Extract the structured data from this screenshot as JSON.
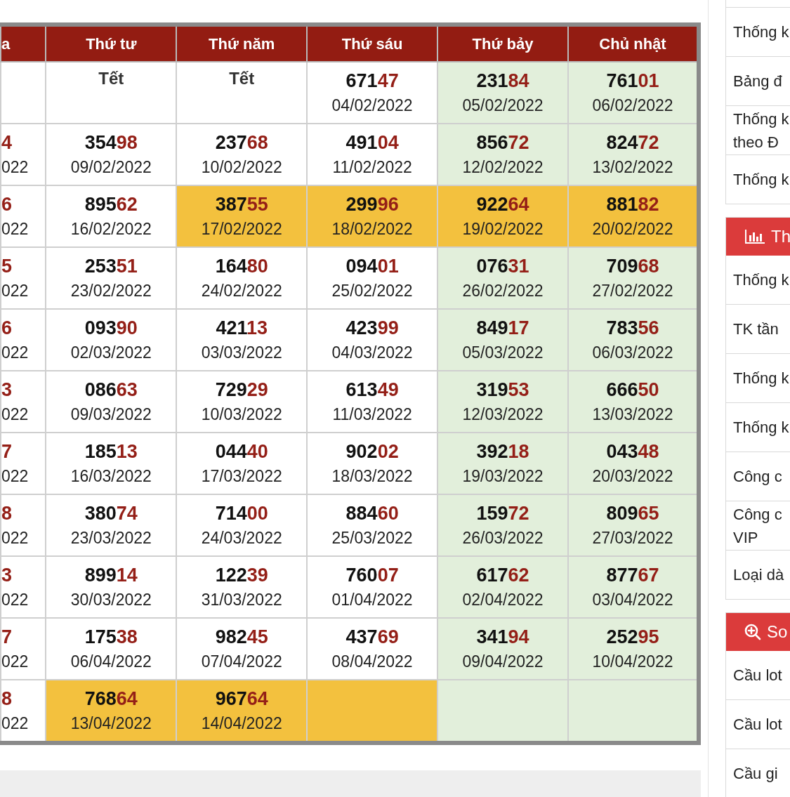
{
  "table": {
    "columns": [
      "a",
      "Thứ tư",
      "Thứ năm",
      "Thứ sáu",
      "Thứ bảy",
      "Chủ nhật"
    ],
    "rows": [
      [
        {
          "kind": "empty",
          "color": "#ffffff"
        },
        {
          "kind": "holiday",
          "text": "Tết",
          "color": "#ffffff"
        },
        {
          "kind": "holiday",
          "text": "Tết",
          "color": "#ffffff"
        },
        {
          "kind": "result",
          "head": "671",
          "tail": "47",
          "date": "04/02/2022",
          "color": "#ffffff"
        },
        {
          "kind": "result",
          "head": "231",
          "tail": "84",
          "date": "05/02/2022",
          "color": "#e2efdb"
        },
        {
          "kind": "result",
          "head": "761",
          "tail": "01",
          "date": "06/02/2022",
          "color": "#e2efdb"
        }
      ],
      [
        {
          "kind": "result",
          "tail": "4",
          "date": "022",
          "color": "#ffffff"
        },
        {
          "kind": "result",
          "head": "354",
          "tail": "98",
          "date": "09/02/2022",
          "color": "#ffffff"
        },
        {
          "kind": "result",
          "head": "237",
          "tail": "68",
          "date": "10/02/2022",
          "color": "#ffffff"
        },
        {
          "kind": "result",
          "head": "491",
          "tail": "04",
          "date": "11/02/2022",
          "color": "#ffffff"
        },
        {
          "kind": "result",
          "head": "856",
          "tail": "72",
          "date": "12/02/2022",
          "color": "#e2efdb"
        },
        {
          "kind": "result",
          "head": "824",
          "tail": "72",
          "date": "13/02/2022",
          "color": "#e2efdb"
        }
      ],
      [
        {
          "kind": "result",
          "tail": "6",
          "date": "022",
          "color": "#ffffff"
        },
        {
          "kind": "result",
          "head": "895",
          "tail": "62",
          "date": "16/02/2022",
          "color": "#ffffff"
        },
        {
          "kind": "result",
          "head": "387",
          "tail": "55",
          "date": "17/02/2022",
          "color": "#f3c13e"
        },
        {
          "kind": "result",
          "head": "299",
          "tail": "96",
          "date": "18/02/2022",
          "color": "#f3c13e"
        },
        {
          "kind": "result",
          "head": "922",
          "tail": "64",
          "date": "19/02/2022",
          "color": "#f3c13e"
        },
        {
          "kind": "result",
          "head": "881",
          "tail": "82",
          "date": "20/02/2022",
          "color": "#f3c13e"
        }
      ],
      [
        {
          "kind": "result",
          "tail": "5",
          "date": "022",
          "color": "#ffffff"
        },
        {
          "kind": "result",
          "head": "253",
          "tail": "51",
          "date": "23/02/2022",
          "color": "#ffffff"
        },
        {
          "kind": "result",
          "head": "164",
          "tail": "80",
          "date": "24/02/2022",
          "color": "#ffffff"
        },
        {
          "kind": "result",
          "head": "094",
          "tail": "01",
          "date": "25/02/2022",
          "color": "#ffffff"
        },
        {
          "kind": "result",
          "head": "076",
          "tail": "31",
          "date": "26/02/2022",
          "color": "#e2efdb"
        },
        {
          "kind": "result",
          "head": "709",
          "tail": "68",
          "date": "27/02/2022",
          "color": "#e2efdb"
        }
      ],
      [
        {
          "kind": "result",
          "tail": "6",
          "date": "022",
          "color": "#ffffff"
        },
        {
          "kind": "result",
          "head": "093",
          "tail": "90",
          "date": "02/03/2022",
          "color": "#ffffff"
        },
        {
          "kind": "result",
          "head": "421",
          "tail": "13",
          "date": "03/03/2022",
          "color": "#ffffff"
        },
        {
          "kind": "result",
          "head": "423",
          "tail": "99",
          "date": "04/03/2022",
          "color": "#ffffff"
        },
        {
          "kind": "result",
          "head": "849",
          "tail": "17",
          "date": "05/03/2022",
          "color": "#e2efdb"
        },
        {
          "kind": "result",
          "head": "783",
          "tail": "56",
          "date": "06/03/2022",
          "color": "#e2efdb"
        }
      ],
      [
        {
          "kind": "result",
          "tail": "3",
          "date": "022",
          "color": "#ffffff"
        },
        {
          "kind": "result",
          "head": "086",
          "tail": "63",
          "date": "09/03/2022",
          "color": "#ffffff"
        },
        {
          "kind": "result",
          "head": "729",
          "tail": "29",
          "date": "10/03/2022",
          "color": "#ffffff"
        },
        {
          "kind": "result",
          "head": "613",
          "tail": "49",
          "date": "11/03/2022",
          "color": "#ffffff"
        },
        {
          "kind": "result",
          "head": "319",
          "tail": "53",
          "date": "12/03/2022",
          "color": "#e2efdb"
        },
        {
          "kind": "result",
          "head": "666",
          "tail": "50",
          "date": "13/03/2022",
          "color": "#e2efdb"
        }
      ],
      [
        {
          "kind": "result",
          "tail": "7",
          "date": "022",
          "color": "#ffffff"
        },
        {
          "kind": "result",
          "head": "185",
          "tail": "13",
          "date": "16/03/2022",
          "color": "#ffffff"
        },
        {
          "kind": "result",
          "head": "044",
          "tail": "40",
          "date": "17/03/2022",
          "color": "#ffffff"
        },
        {
          "kind": "result",
          "head": "902",
          "tail": "02",
          "date": "18/03/2022",
          "color": "#ffffff"
        },
        {
          "kind": "result",
          "head": "392",
          "tail": "18",
          "date": "19/03/2022",
          "color": "#e2efdb"
        },
        {
          "kind": "result",
          "head": "043",
          "tail": "48",
          "date": "20/03/2022",
          "color": "#e2efdb"
        }
      ],
      [
        {
          "kind": "result",
          "tail": "8",
          "date": "022",
          "color": "#ffffff"
        },
        {
          "kind": "result",
          "head": "380",
          "tail": "74",
          "date": "23/03/2022",
          "color": "#ffffff"
        },
        {
          "kind": "result",
          "head": "714",
          "tail": "00",
          "date": "24/03/2022",
          "color": "#ffffff"
        },
        {
          "kind": "result",
          "head": "884",
          "tail": "60",
          "date": "25/03/2022",
          "color": "#ffffff"
        },
        {
          "kind": "result",
          "head": "159",
          "tail": "72",
          "date": "26/03/2022",
          "color": "#e2efdb"
        },
        {
          "kind": "result",
          "head": "809",
          "tail": "65",
          "date": "27/03/2022",
          "color": "#e2efdb"
        }
      ],
      [
        {
          "kind": "result",
          "tail": "3",
          "date": "022",
          "color": "#ffffff"
        },
        {
          "kind": "result",
          "head": "899",
          "tail": "14",
          "date": "30/03/2022",
          "color": "#ffffff"
        },
        {
          "kind": "result",
          "head": "122",
          "tail": "39",
          "date": "31/03/2022",
          "color": "#ffffff"
        },
        {
          "kind": "result",
          "head": "760",
          "tail": "07",
          "date": "01/04/2022",
          "color": "#ffffff"
        },
        {
          "kind": "result",
          "head": "617",
          "tail": "62",
          "date": "02/04/2022",
          "color": "#e2efdb"
        },
        {
          "kind": "result",
          "head": "877",
          "tail": "67",
          "date": "03/04/2022",
          "color": "#e2efdb"
        }
      ],
      [
        {
          "kind": "result",
          "tail": "7",
          "date": "022",
          "color": "#ffffff"
        },
        {
          "kind": "result",
          "head": "175",
          "tail": "38",
          "date": "06/04/2022",
          "color": "#ffffff"
        },
        {
          "kind": "result",
          "head": "982",
          "tail": "45",
          "date": "07/04/2022",
          "color": "#ffffff"
        },
        {
          "kind": "result",
          "head": "437",
          "tail": "69",
          "date": "08/04/2022",
          "color": "#ffffff"
        },
        {
          "kind": "result",
          "head": "341",
          "tail": "94",
          "date": "09/04/2022",
          "color": "#e2efdb"
        },
        {
          "kind": "result",
          "head": "252",
          "tail": "95",
          "date": "10/04/2022",
          "color": "#e2efdb"
        }
      ],
      [
        {
          "kind": "result",
          "tail": "8",
          "date": "022",
          "color": "#ffffff"
        },
        {
          "kind": "result",
          "head": "768",
          "tail": "64",
          "date": "13/04/2022",
          "color": "#f3c13e"
        },
        {
          "kind": "result",
          "head": "967",
          "tail": "64",
          "date": "14/04/2022",
          "color": "#f3c13e"
        },
        {
          "kind": "empty",
          "color": "#f3c13e"
        },
        {
          "kind": "empty",
          "color": "#e2efdb"
        },
        {
          "kind": "empty",
          "color": "#e2efdb"
        }
      ]
    ]
  },
  "sidebar": {
    "sections": [
      {
        "items": [
          {
            "lines": [
              "Thống k"
            ]
          },
          {
            "lines": [
              "Bảng đ"
            ]
          },
          {
            "lines": [
              "Thống k",
              "theo Đ"
            ]
          },
          {
            "lines": [
              "Thống k"
            ]
          }
        ]
      },
      {
        "header": {
          "kind": "chart",
          "title": "Th"
        },
        "items": [
          {
            "lines": [
              "Thống k"
            ]
          },
          {
            "lines": [
              "TK tần"
            ]
          },
          {
            "lines": [
              "Thống k"
            ]
          },
          {
            "lines": [
              "Thống k"
            ]
          },
          {
            "lines": [
              "Công c"
            ]
          },
          {
            "lines": [
              "Công c",
              "VIP"
            ]
          },
          {
            "lines": [
              "Loại dà"
            ]
          }
        ]
      },
      {
        "header": {
          "kind": "search",
          "title": "So"
        },
        "items": [
          {
            "lines": [
              "Cầu lot"
            ]
          },
          {
            "lines": [
              "Cầu lot"
            ]
          },
          {
            "lines": [
              "Cầu gi"
            ]
          }
        ]
      }
    ]
  }
}
